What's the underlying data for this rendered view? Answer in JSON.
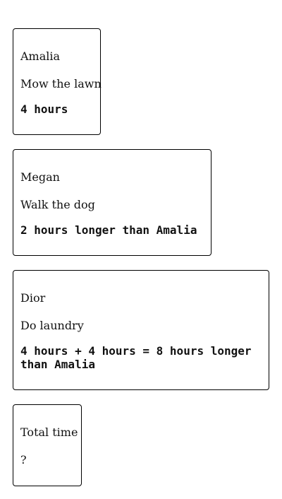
{
  "cards": [
    {
      "name": "Amalia",
      "task": "Mow the lawn",
      "time": "4 hours"
    },
    {
      "name": "Megan",
      "task": "Walk the dog",
      "time": "2 hours longer than Amalia"
    },
    {
      "name": "Dior",
      "task": "Do laundry",
      "time": "4 hours + 4 hours = 8 hours longer than Amalia"
    }
  ],
  "total": {
    "label": "Total time",
    "value": "?"
  }
}
